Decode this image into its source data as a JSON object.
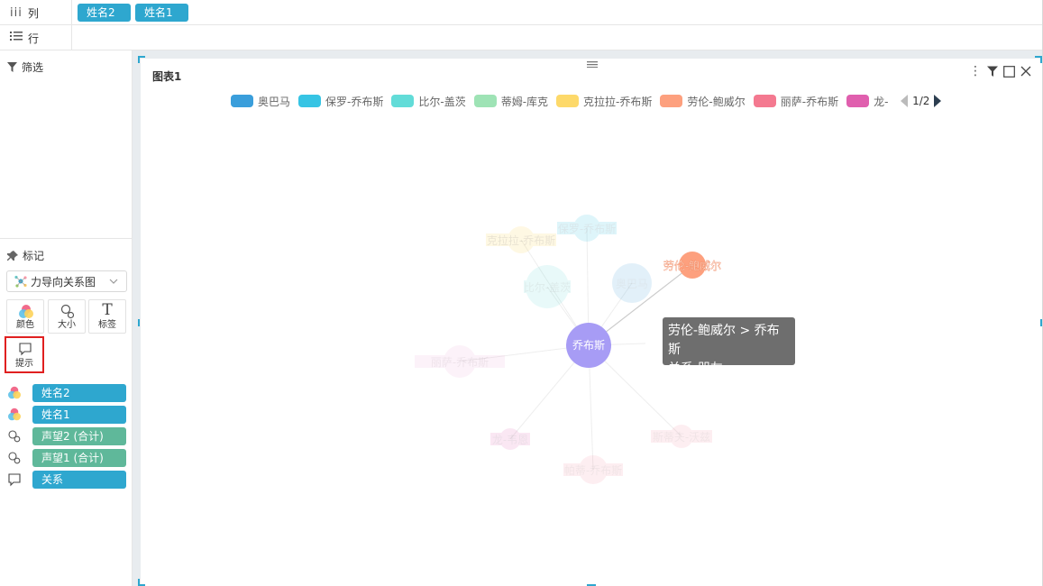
{
  "shelves": {
    "columns": {
      "icon": "columns-icon",
      "label": "列",
      "pills": [
        "姓名2",
        "姓名1"
      ]
    },
    "rows": {
      "icon": "rows-icon",
      "label": "行",
      "pills": []
    }
  },
  "left_panel": {
    "filter_title": "筛选",
    "marks_title": "标记",
    "chart_type": "力导向关系图",
    "mark_buttons": {
      "color": "颜色",
      "size": "大小",
      "label": "标签",
      "tooltip": "提示",
      "label_glyph": "T"
    },
    "fields": [
      {
        "icon": "color-icon",
        "name": "姓名2",
        "color": "#2ea7cf"
      },
      {
        "icon": "color-icon",
        "name": "姓名1",
        "color": "#2ea7cf"
      },
      {
        "icon": "size-icon",
        "name": "声望2 (合计)",
        "color": "#5fb89a"
      },
      {
        "icon": "size-icon",
        "name": "声望1 (合计)",
        "color": "#5fb89a"
      },
      {
        "icon": "tooltip-icon",
        "name": "关系",
        "color": "#2ea7cf"
      }
    ]
  },
  "chart": {
    "title": "图表1",
    "legend": {
      "items": [
        {
          "name": "奥巴马",
          "color": "#3a9edb"
        },
        {
          "name": "保罗-乔布斯",
          "color": "#36c4e4"
        },
        {
          "name": "比尔-盖茨",
          "color": "#62dcd8"
        },
        {
          "name": "蒂姆-库克",
          "color": "#9ee3b5"
        },
        {
          "name": "克拉拉-乔布斯",
          "color": "#fdd96a"
        },
        {
          "name": "劳伦-鲍威尔",
          "color": "#fda07e"
        },
        {
          "name": "丽萨-乔布斯",
          "color": "#f47990"
        },
        {
          "name": "龙-",
          "color": "#e05fae"
        }
      ],
      "page": "1/2"
    },
    "center_node": {
      "name": "乔布斯",
      "color": "#a79cf5"
    },
    "highlighted_node": {
      "name": "劳伦-鲍威尔",
      "color": "#fda07e"
    },
    "faded_nodes": [
      {
        "name": "保罗-乔布斯",
        "color": "#36c4e4"
      },
      {
        "name": "克拉拉-乔布斯",
        "color": "#fdd96a"
      },
      {
        "name": "比尔-盖茨",
        "color": "#62dcd8"
      },
      {
        "name": "奥巴马",
        "color": "#3a9edb"
      },
      {
        "name": "丽萨-乔布斯",
        "color": "#f0a8d8"
      },
      {
        "name": "龙-韦恩",
        "color": "#e05fae"
      },
      {
        "name": "帕蒂-乔布斯",
        "color": "#f47990"
      },
      {
        "name": "斯蒂夫-沃兹",
        "color": "#f47990"
      }
    ],
    "tooltip": {
      "line1": "劳伦-鲍威尔 > 乔布斯",
      "line2": "关系:朋友"
    }
  }
}
